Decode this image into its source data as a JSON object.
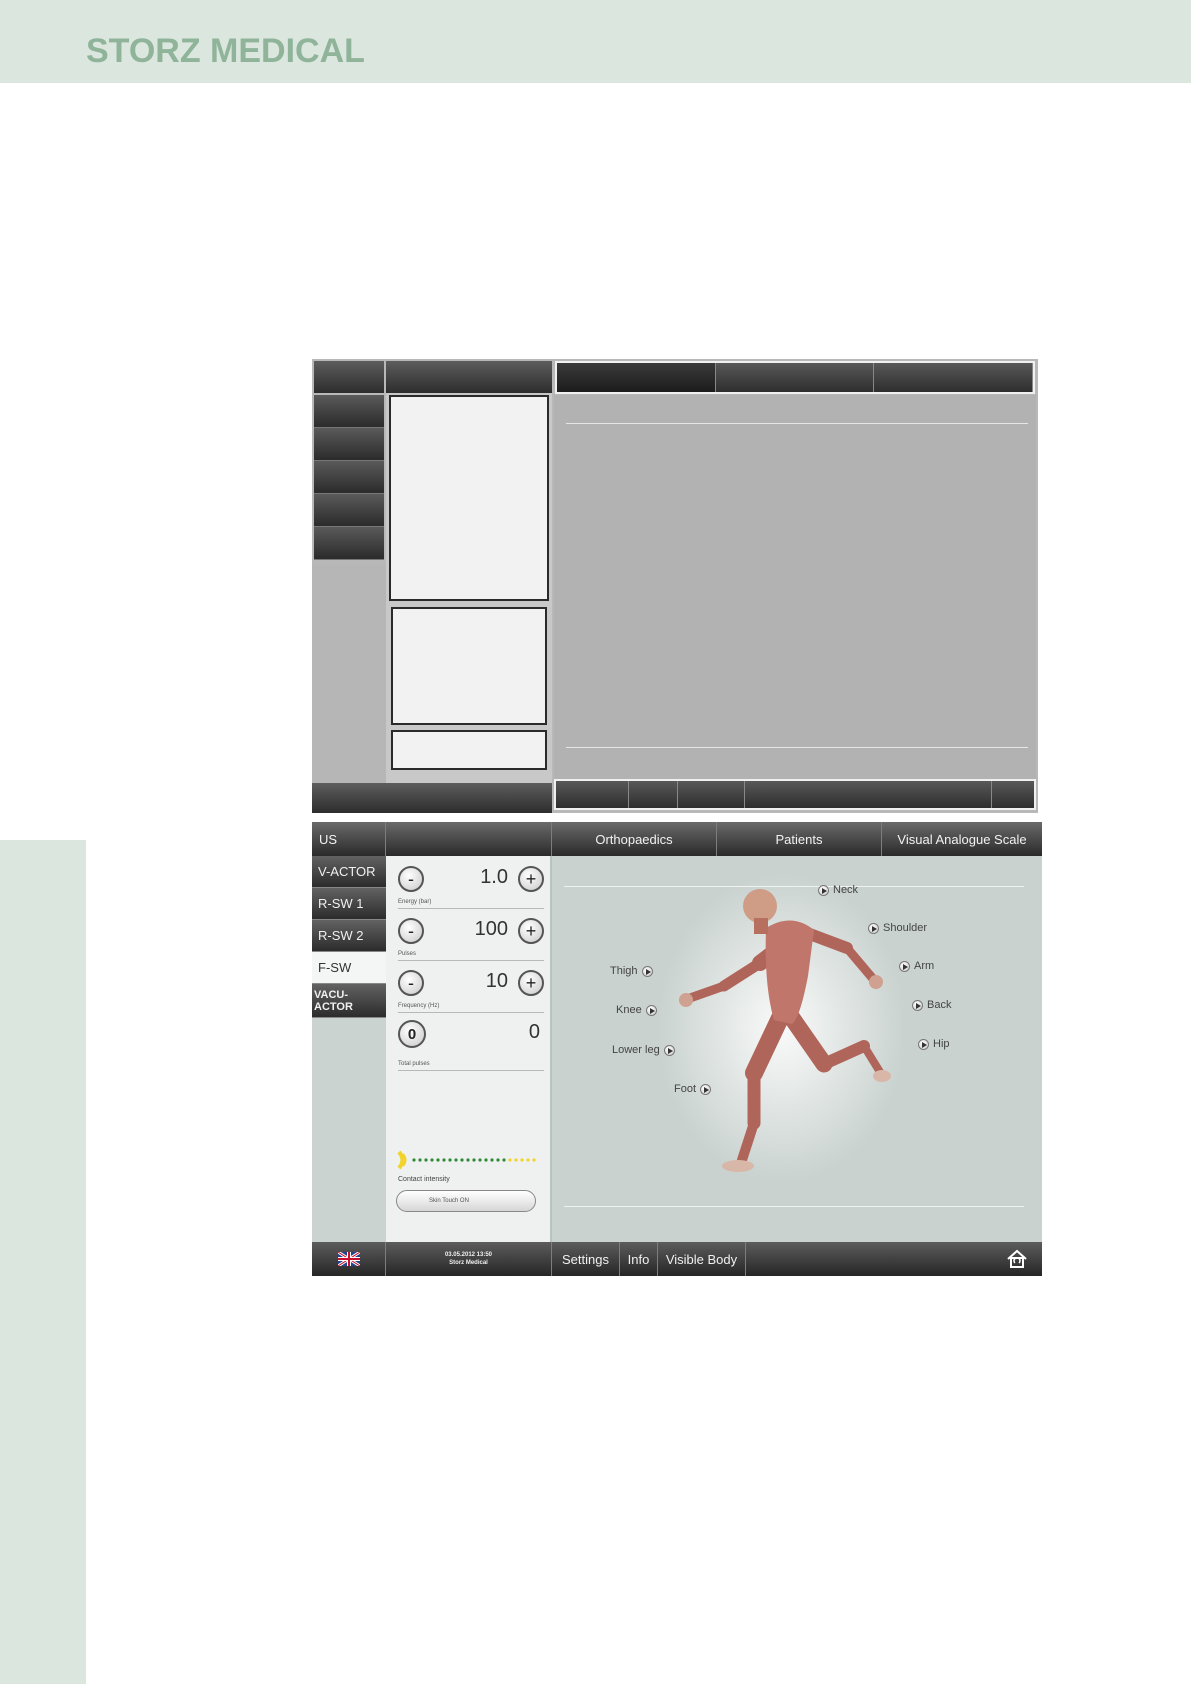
{
  "brand": {
    "name": "STORZ MEDICAL"
  },
  "ui": {
    "tabs": [
      {
        "id": "us",
        "label": "US"
      },
      {
        "id": "blank",
        "label": ""
      },
      {
        "id": "ortho",
        "label": "Orthopaedics"
      },
      {
        "id": "patients",
        "label": "Patients"
      },
      {
        "id": "vas",
        "label": "Visual Analogue Scale"
      }
    ],
    "modes": [
      {
        "label": "V-ACTOR",
        "active": false
      },
      {
        "label": "R-SW 1",
        "active": false
      },
      {
        "label": "R-SW 2",
        "active": false
      },
      {
        "label": "F-SW",
        "active": true
      },
      {
        "label": "VACU-ACTOR",
        "active": false
      }
    ],
    "params": {
      "energy": {
        "value": "1.0",
        "label": "Energy (bar)",
        "minus": "-",
        "plus": "+"
      },
      "pulses": {
        "value": "100",
        "label": "Pulses",
        "minus": "-",
        "plus": "+"
      },
      "frequency": {
        "value": "10",
        "label": "Frequency (Hz)",
        "minus": "-",
        "plus": "+"
      },
      "total": {
        "value": "0",
        "label": "Total pulses",
        "reset": "0"
      }
    },
    "contact": {
      "label": "Contact intensity",
      "skin_touch": "Skin Touch ON"
    },
    "body_links": [
      {
        "id": "neck",
        "label": "Neck"
      },
      {
        "id": "shoulder",
        "label": "Shoulder"
      },
      {
        "id": "arm",
        "label": "Arm"
      },
      {
        "id": "back",
        "label": "Back"
      },
      {
        "id": "hip",
        "label": "Hip"
      },
      {
        "id": "thigh",
        "label": "Thigh"
      },
      {
        "id": "knee",
        "label": "Knee"
      },
      {
        "id": "lower-leg",
        "label": "Lower leg"
      },
      {
        "id": "foot",
        "label": "Foot"
      }
    ],
    "footer": {
      "datetime": "03.05.2012 13:50",
      "company": "Storz Medical",
      "settings": "Settings",
      "info": "Info",
      "visible_body": "Visible Body"
    }
  },
  "colors": {
    "header_bg": "#dbe6de",
    "brand_green": "#8fb49a",
    "contact_yellow": "#f2d32a",
    "contact_green": "#2f8a36"
  }
}
